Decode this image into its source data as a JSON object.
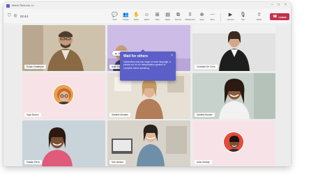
{
  "window": {
    "title": "Marie Resume..In"
  },
  "toolbar": {
    "timer": "22:44",
    "buttons": [
      {
        "name": "chat",
        "label": "Chat",
        "glyph": "💬"
      },
      {
        "name": "people",
        "label": "People",
        "glyph": "👥"
      },
      {
        "name": "raise",
        "label": "Raise",
        "glyph": "✋"
      },
      {
        "name": "react",
        "label": "React",
        "glyph": "☺"
      },
      {
        "name": "view",
        "label": "View",
        "glyph": "⊞"
      },
      {
        "name": "notes",
        "label": "Notes",
        "glyph": "▤"
      },
      {
        "name": "rooms",
        "label": "Rooms",
        "glyph": "⧉"
      },
      {
        "name": "whiteboard",
        "label": "Whiteboard",
        "glyph": "⌷"
      },
      {
        "name": "apps",
        "label": "Apps",
        "glyph": "⊕"
      },
      {
        "name": "more",
        "label": "More",
        "glyph": "⋯"
      },
      {
        "name": "camera",
        "label": "Camera",
        "glyph": "▶"
      },
      {
        "name": "mic",
        "label": "Mic",
        "glyph": "🎙"
      },
      {
        "name": "share",
        "label": "Share",
        "glyph": "⇧"
      }
    ],
    "leave_label": "Leave"
  },
  "interpretation_pill": "Interpreting for others",
  "popup": {
    "title": "Wait for others",
    "body": "Interpreters may use longer in each language, a phrase out for our interpretation speaker to complete before speaking."
  },
  "participants": [
    {
      "name": "Eshan Chatterjee",
      "bg": "#d9cbb8"
    },
    {
      "name": "Aakif Pagano",
      "bg": "#d6c7ea"
    },
    {
      "name": "Charlotte De Crum",
      "bg": "#dcdcdc"
    },
    {
      "name": "Sayo Burton",
      "bg": "#f7e3e7"
    },
    {
      "name": "Danielle Morales",
      "bg": "#e6dfd4"
    },
    {
      "name": "Danielle Booker",
      "bg": "#cfd8d2"
    },
    {
      "name": "Saadia Fernz",
      "bg": "#ccd6dd"
    },
    {
      "name": "Kat Larsson",
      "bg": "#d8d4cc"
    },
    {
      "name": "Arlan Munoje",
      "bg": "#f7e3e7"
    }
  ],
  "colors": {
    "accent": "#5b5fc7",
    "leave": "#c4314b"
  }
}
